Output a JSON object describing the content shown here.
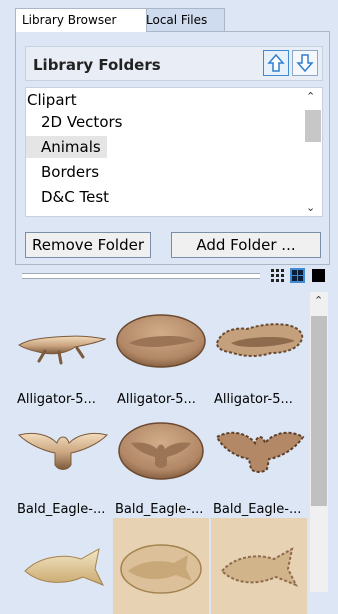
{
  "tabs": [
    {
      "label": "Library Browser",
      "active": true
    },
    {
      "label": "Local Files",
      "active": false
    }
  ],
  "library_folders": {
    "title": "Library Folders",
    "move_up_icon": "arrow-up-icon",
    "move_down_icon": "arrow-down-icon",
    "items": [
      "Clipart",
      "2D Vectors",
      "Animals",
      "Borders",
      "D&C Test"
    ],
    "selected": "Animals",
    "remove_button": "Remove Folder",
    "add_button": "Add Folder ..."
  },
  "view_modes": [
    "small-grid-icon",
    "large-grid-icon",
    "single-view-icon"
  ],
  "active_view_mode": "large-grid-icon",
  "thumbnails": [
    {
      "caption": "Alligator-5...",
      "kind": "alligator-flat"
    },
    {
      "caption": "Alligator-5...",
      "kind": "alligator-oval"
    },
    {
      "caption": "Alligator-5...",
      "kind": "alligator-rough"
    },
    {
      "caption": "Bald_Eagle-...",
      "kind": "eagle-flat"
    },
    {
      "caption": "Bald_Eagle-...",
      "kind": "eagle-oval"
    },
    {
      "caption": "Bald_Eagle-...",
      "kind": "eagle-rough"
    },
    {
      "caption": "",
      "kind": "fish-flat"
    },
    {
      "caption": "",
      "kind": "fish-oval"
    },
    {
      "caption": "",
      "kind": "fish-rough"
    }
  ],
  "colors": {
    "panel_bg": "#dce6f4",
    "carving_light": "#e3c9a6",
    "carving_dark": "#8d6b4c",
    "accent": "#3f8ad3"
  }
}
